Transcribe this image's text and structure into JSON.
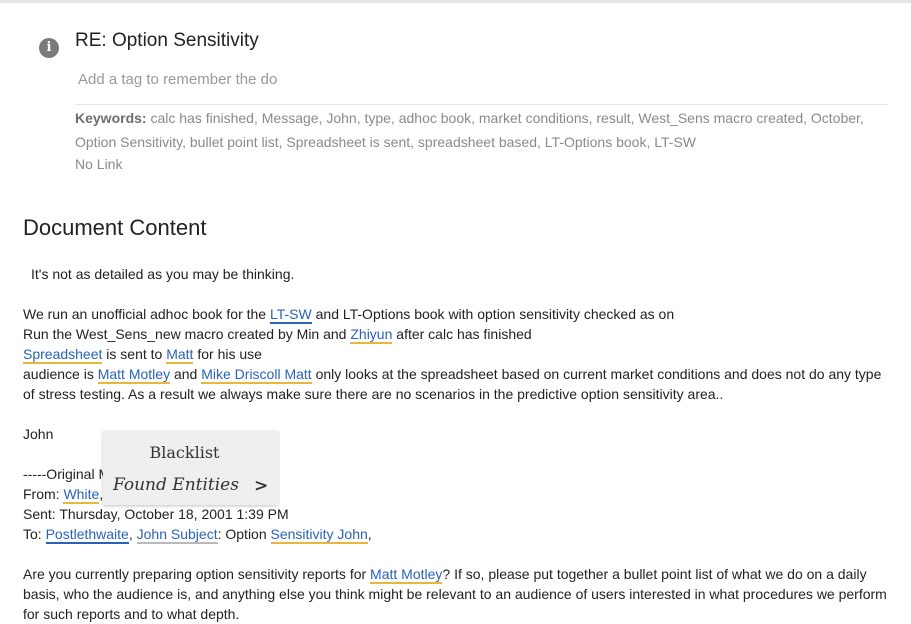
{
  "header": {
    "title": "RE: Option Sensitivity",
    "tag_placeholder": "Add a tag to remember the document",
    "keywords_label": "Keywords:",
    "keywords_text": "calc has finished, Message, John, type, adhoc book, market conditions, result, West_Sens macro created, October, Option Sensitivity, bullet point list, Spreadsheet is sent, spreadsheet based, LT-Options book, LT-SW",
    "no_link": "No Link"
  },
  "document": {
    "heading": "Document Content",
    "intro": "It's not as detailed as you may be thinking.",
    "p1": {
      "t1": "We run an unofficial adhoc book for the ",
      "e1": "LT-SW",
      "t2": " and LT-Options book with option sensitivity checked as on"
    },
    "p2": {
      "t1": "Run the West_Sens_new macro created by Min and ",
      "e1": "Zhiyun",
      "t2": " after calc has finished"
    },
    "p3": {
      "e1": "Spreadsheet",
      "t1": " is sent to ",
      "e2": "Matt",
      "t2": " for his use"
    },
    "p4": {
      "t1": "audience is ",
      "e1": "Matt Motley",
      "t2": " and ",
      "e2": "Mike Driscoll Matt",
      "t3": " only looks at the spreadsheet based on current market conditions and does not do any type of stress testing. As a result we always make sure there are no scenarios in the predictive option sensitivity area.."
    },
    "signature": "John",
    "original_label": "-----Original M",
    "from": {
      "label": "From: ",
      "e1": "White",
      "t1": ","
    },
    "sent": "Sent: Thursday, October 18, 2001 1:39 PM",
    "to": {
      "label": "To: ",
      "e1": "Postlethwaite",
      "sep": ", ",
      "e2": "John Subject",
      "t1": ": Option ",
      "e3": "Sensitivity John",
      "t2": ","
    },
    "last": {
      "t1": "Are you currently preparing option sensitivity reports for ",
      "e1": "Matt Motley",
      "t2": "? If so, please put together a bullet point list of what we do on a daily basis, who the audience is, and anything else you think might be relevant to an audience of users interested in what procedures we perform for such reports and to what depth."
    }
  },
  "blacklist_panel": {
    "title": "Blacklist",
    "subtitle": "Found Entities",
    "arrow": ">"
  },
  "icons": {
    "info": "info-icon"
  },
  "colors": {
    "entity_link": "#2a62b8",
    "underline_person": "#e8b73b",
    "underline_org": "#2a62b8",
    "underline_misc": "#b9b9b9"
  }
}
